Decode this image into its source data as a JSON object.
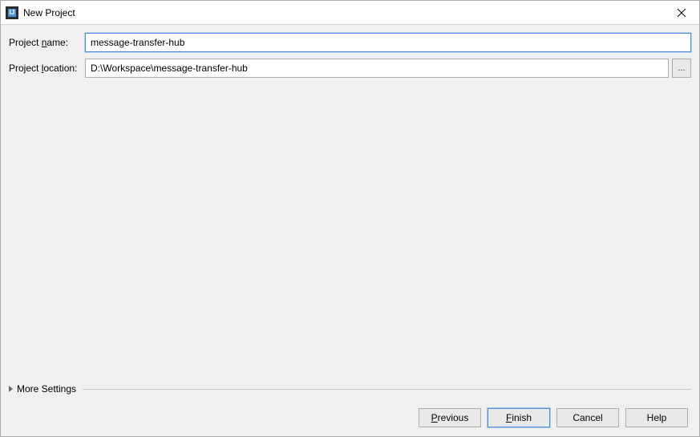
{
  "window": {
    "title": "New Project"
  },
  "form": {
    "project_name_label_pre": "Project ",
    "project_name_label_u": "n",
    "project_name_label_post": "ame:",
    "project_name_value": "message-transfer-hub",
    "project_location_label_pre": "Project ",
    "project_location_label_u": "l",
    "project_location_label_post": "ocation:",
    "project_location_value": "D:\\Workspace\\message-transfer-hub",
    "browse_label": "..."
  },
  "more_settings": {
    "label": "More Settings"
  },
  "buttons": {
    "previous_u": "P",
    "previous_post": "revious",
    "finish_u": "F",
    "finish_post": "inish",
    "cancel": "Cancel",
    "help": "Help"
  }
}
